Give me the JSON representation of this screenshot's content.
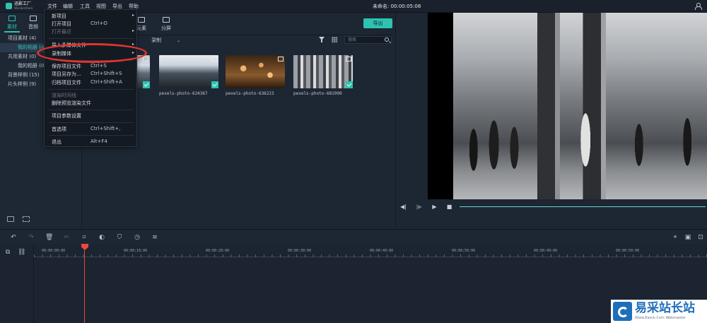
{
  "app": {
    "logo_title": "迅影工厂",
    "logo_sub": "Wondershare",
    "project_title": "未命名: 00:00:05:08"
  },
  "menubar": [
    "文件",
    "编辑",
    "工具",
    "视图",
    "导出",
    "帮助"
  ],
  "left_panel": {
    "tabs": [
      {
        "label": "素材",
        "icon": "folder-icon",
        "active": true
      },
      {
        "label": "音频",
        "icon": "music-note-icon",
        "active": false
      }
    ],
    "tree": [
      {
        "label": "项目素材 (4)",
        "level": 1,
        "selected": false
      },
      {
        "label": "我的相册 (4)",
        "level": 2,
        "selected": true
      },
      {
        "label": "共用素材 (0)",
        "level": 1,
        "selected": false
      },
      {
        "label": "我的相册 (0)",
        "level": 2,
        "selected": false
      },
      {
        "label": "背景样例 (15)",
        "level": 1,
        "selected": false
      },
      {
        "label": "片头样例 (9)",
        "level": 1,
        "selected": false
      }
    ]
  },
  "media": {
    "tabs": [
      {
        "label": "元素",
        "icon": "sticker-icon"
      },
      {
        "label": "分屏",
        "icon": "split-screen-icon"
      }
    ],
    "export_label": "导出",
    "filter_label": "录制",
    "search_placeholder": "搜索",
    "thumbnails": [
      {
        "caption": "",
        "style": "t1"
      },
      {
        "caption": "pexels-photo-624367",
        "style": "t2"
      },
      {
        "caption": "pexels-photo-636223",
        "style": "t3"
      },
      {
        "caption": "pexels-photo-681990",
        "style": "t4"
      }
    ]
  },
  "file_menu": {
    "items": [
      {
        "label": "新项目",
        "shortcut": "",
        "arrow": true,
        "disabled": false
      },
      {
        "label": "打开项目",
        "shortcut": "Ctrl+O",
        "arrow": false,
        "disabled": false
      },
      {
        "label": "打开最近",
        "shortcut": "",
        "arrow": true,
        "disabled": true
      },
      {
        "label": "导入多媒体文件",
        "shortcut": "",
        "arrow": true,
        "disabled": false
      },
      {
        "label": "录制媒体",
        "shortcut": "",
        "arrow": true,
        "disabled": false
      },
      {
        "label": "保存项目文件",
        "shortcut": "Ctrl+S",
        "arrow": false,
        "disabled": false
      },
      {
        "label": "项目另存为...",
        "shortcut": "Ctrl+Shift+S",
        "arrow": false,
        "disabled": false
      },
      {
        "label": "归档项目文件",
        "shortcut": "Ctrl+Shift+A",
        "arrow": false,
        "disabled": false
      },
      {
        "label": "渲染时间线",
        "shortcut": "",
        "arrow": false,
        "disabled": true
      },
      {
        "label": "删除预览渲染文件",
        "shortcut": "",
        "arrow": false,
        "disabled": false
      },
      {
        "label": "项目参数设置",
        "shortcut": "",
        "arrow": false,
        "disabled": false
      },
      {
        "label": "首选项",
        "shortcut": "Ctrl+Shift+,",
        "arrow": false,
        "disabled": false
      },
      {
        "label": "退出",
        "shortcut": "Alt+F4",
        "arrow": false,
        "disabled": false
      }
    ]
  },
  "timeline": {
    "ruler": [
      "00:00:00:00",
      "00:00:10:00",
      "00:00:20:00",
      "00:00:30:00",
      "00:00:40:00",
      "00:00:50:00",
      "00:00:40:00",
      "00:00:50:00"
    ]
  },
  "watermark": {
    "text": "易采站长站",
    "url": "Www.Easck.Com Webmaster"
  },
  "colors": {
    "accent": "#2ec3b0",
    "playhead": "#e84a3c",
    "highlight": "#e0342e"
  }
}
